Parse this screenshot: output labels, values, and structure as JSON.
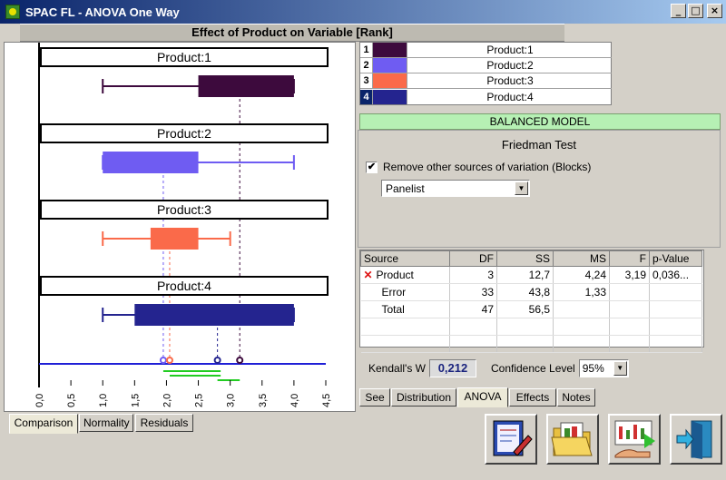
{
  "window": {
    "title": "SPAC FL - ANOVA One Way",
    "minimize_label": "_",
    "maximize_label": "□",
    "close_label": "×"
  },
  "chart_header": "Effect of Product on Variable [Rank]",
  "chart_data": {
    "type": "box",
    "xlim": [
      0,
      4.5
    ],
    "x_ticks": [
      "0,0",
      "0,5",
      "1,0",
      "1,5",
      "2,0",
      "2,5",
      "3,0",
      "3,5",
      "4,0",
      "4,5"
    ],
    "series": [
      {
        "name": "Product:1",
        "color": "#3d0a3d",
        "whisker_low": 1.0,
        "q1": 2.5,
        "q3": 4.0,
        "whisker_high": 4.0,
        "mean": 3.15
      },
      {
        "name": "Product:2",
        "color": "#6f5cf2",
        "whisker_low": 1.0,
        "q1": 1.0,
        "q3": 2.5,
        "whisker_high": 4.0,
        "mean": 1.95
      },
      {
        "name": "Product:3",
        "color": "#fa6a4a",
        "whisker_low": 1.0,
        "q1": 1.75,
        "q3": 2.5,
        "whisker_high": 3.0,
        "mean": 2.05
      },
      {
        "name": "Product:4",
        "color": "#24248f",
        "whisker_low": 1.0,
        "q1": 1.5,
        "q3": 4.0,
        "whisker_high": 4.0,
        "mean": 2.8
      }
    ],
    "groupings": [
      {
        "from": 1.95,
        "to": 2.85,
        "color": "#22cc22"
      },
      {
        "from": 2.05,
        "to": 2.85,
        "color": "#22cc22"
      },
      {
        "from": 2.8,
        "to": 3.15,
        "color": "#22cc22"
      }
    ]
  },
  "left_tabs": [
    "Comparison",
    "Normality",
    "Residuals"
  ],
  "legend": [
    {
      "num": "1",
      "label": "Product:1",
      "color": "#3d0a3d"
    },
    {
      "num": "2",
      "label": "Product:2",
      "color": "#6f5cf2"
    },
    {
      "num": "3",
      "label": "Product:3",
      "color": "#fa6a4a"
    },
    {
      "num": "4",
      "label": "Product:4",
      "color": "#24248f"
    }
  ],
  "model_banner": "BALANCED MODEL",
  "test_name": "Friedman Test",
  "remove_sources": {
    "checked": "✔",
    "label": "Remove other sources of variation (Blocks)"
  },
  "block_select": "Panelist",
  "anova_table": {
    "headers": [
      "Source",
      "DF",
      "SS",
      "MS",
      "F",
      "p-Value"
    ],
    "rows": [
      {
        "mark": "✕",
        "source": "Product",
        "df": "3",
        "ss": "12,7",
        "ms": "4,24",
        "f": "3,19",
        "p": "0,036..."
      },
      {
        "mark": "",
        "source": "Error",
        "df": "33",
        "ss": "43,8",
        "ms": "1,33",
        "f": "",
        "p": ""
      },
      {
        "mark": "",
        "source": "Total",
        "df": "47",
        "ss": "56,5",
        "ms": "",
        "f": "",
        "p": ""
      }
    ]
  },
  "kendall": {
    "label": "Kendall's W",
    "value": "0,212"
  },
  "confidence": {
    "label": "Confidence Level",
    "value": "95%"
  },
  "right_tabs": [
    "See",
    "Distribution",
    "ANOVA",
    "Effects",
    "Notes"
  ],
  "toolbar_icons": [
    "report-icon",
    "open-folder-icon",
    "analysis-icon",
    "exit-icon"
  ]
}
